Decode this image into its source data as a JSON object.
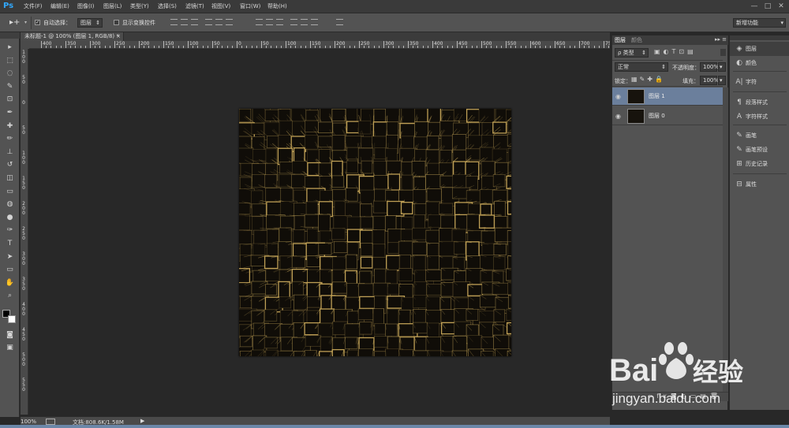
{
  "app": {
    "logo_text": "Ps"
  },
  "menubar": {
    "items": [
      "文件(F)",
      "编辑(E)",
      "图像(I)",
      "图层(L)",
      "类型(Y)",
      "选择(S)",
      "滤镜(T)",
      "视图(V)",
      "窗口(W)",
      "帮助(H)"
    ],
    "window_controls": {
      "minimize": "—",
      "restore": "□",
      "close": "✕"
    }
  },
  "options": {
    "tool_icon": "move-tool-icon",
    "auto_select_label": "自动选择：",
    "auto_select_checked": true,
    "auto_select_target": "图层",
    "show_transform_label": "显示变换控件",
    "show_transform_checked": false,
    "workspace": "新增功能"
  },
  "document": {
    "tab_title": "未标题-1 @ 100% (图层 1, RGB/8) *",
    "close_label": "×",
    "zoom": "100%",
    "doc_info": "文档:808.6K/1.58M"
  },
  "ruler": {
    "h_labels": [
      "400",
      "350",
      "300",
      "250",
      "200",
      "150",
      "100",
      "50",
      "0",
      "50",
      "100",
      "150",
      "200",
      "250",
      "300",
      "350",
      "400",
      "450",
      "500",
      "550",
      "600",
      "650",
      "700",
      "750",
      "800"
    ],
    "v_labels": [
      "1 0 0",
      "5 0",
      "0",
      "5 0",
      "1 0 0",
      "1 5 0",
      "2 0 0",
      "2 5 0",
      "3 0 0",
      "3 5 0",
      "4 0 0",
      "4 5 0",
      "5 0 0",
      "5 5 0"
    ]
  },
  "tools": [
    "move-tool-icon",
    "marquee-icon",
    "lasso-icon",
    "quick-select-icon",
    "crop-icon",
    "eyedropper-icon",
    "healing-brush-icon",
    "brush-icon",
    "clone-stamp-icon",
    "history-brush-icon",
    "eraser-icon",
    "gradient-icon",
    "blur-icon",
    "dodge-icon",
    "pen-icon",
    "type-icon",
    "path-select-icon",
    "rectangle-icon",
    "hand-icon",
    "zoom-icon"
  ],
  "tool_glyphs": [
    "▸",
    "⬚",
    "◌",
    "✎",
    "⊡",
    "✒",
    "✚",
    "✏",
    "⊥",
    "↺",
    "◫",
    "▭",
    "◍",
    "●",
    "✑",
    "T",
    "➤",
    "▭",
    "✋",
    "⌕"
  ],
  "layers_panel": {
    "tabs": [
      "图层",
      "颜色"
    ],
    "filter_label": "ρ 类型",
    "blend_mode": "正常",
    "opacity_label": "不透明度：",
    "opacity_value": "100%",
    "lock_label": "锁定：",
    "fill_label": "填充：",
    "fill_value": "100%",
    "layers": [
      {
        "name": "图层 1",
        "selected": true,
        "visible": true
      },
      {
        "name": "图层 0",
        "selected": false,
        "visible": true
      }
    ],
    "bottom_icons": [
      "link-icon",
      "fx-icon",
      "mask-icon",
      "adjustment-icon",
      "group-icon",
      "new-layer-icon",
      "trash-icon"
    ]
  },
  "right_dock": {
    "items": [
      {
        "label": "图层",
        "icon": "layers-icon",
        "glyph": "◈"
      },
      {
        "label": "颜色",
        "icon": "color-icon",
        "glyph": "◐"
      },
      {
        "label": "字符",
        "icon": "character-icon",
        "glyph": "A|"
      },
      {
        "label": "段落样式",
        "icon": "paragraph-styles-icon",
        "glyph": "¶"
      },
      {
        "label": "字符样式",
        "icon": "character-styles-icon",
        "glyph": "A"
      },
      {
        "label": "画笔",
        "icon": "brush-panel-icon",
        "glyph": "✎"
      },
      {
        "label": "画笔预设",
        "icon": "brush-presets-icon",
        "glyph": "✎"
      },
      {
        "label": "历史记录",
        "icon": "history-icon",
        "glyph": "⊞"
      },
      {
        "label": "属性",
        "icon": "properties-icon",
        "glyph": "⊟"
      }
    ]
  },
  "watermark": {
    "brand_left": "Bai",
    "brand_right": "经验",
    "url": "jingyan.baidu.com"
  },
  "colors": {
    "accent": "#31a8ff",
    "ui_dark": "#535353",
    "canvas_bg": "#282828",
    "artwork_bg": "#0e0b07",
    "artwork_line": "#c8a85a",
    "selected_layer": "#6b7f9c"
  }
}
